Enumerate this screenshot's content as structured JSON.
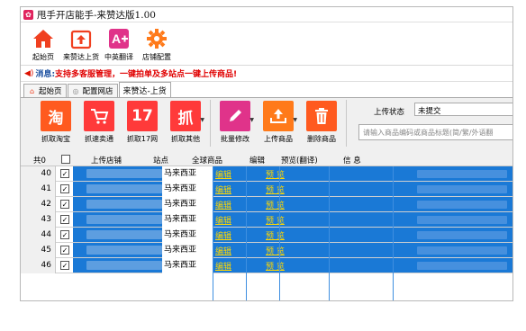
{
  "window": {
    "title": "甩手开店能手-来赞达版1.00"
  },
  "main_toolbar": [
    {
      "label": "起始页",
      "icon": "home-icon"
    },
    {
      "label": "来赞达上货",
      "icon": "upload-box-icon"
    },
    {
      "label": "中英翻译",
      "icon": "translate-icon"
    },
    {
      "label": "店铺配置",
      "icon": "gear-icon"
    }
  ],
  "message": {
    "label": "消息:",
    "text": "支持多客服管理，一键拍单及多站点一键上传商品!"
  },
  "tabs": [
    "起始页",
    "配置网店",
    "来赞达-上货"
  ],
  "tools": [
    {
      "label": "抓取淘宝",
      "glyph": "淘",
      "color": "#ff5a1f"
    },
    {
      "label": "抓速卖通",
      "glyph": "",
      "color": "#ff3a3a"
    },
    {
      "label": "抓取17网",
      "glyph": "17",
      "color": "#ff3a3a"
    },
    {
      "label": "抓取其他",
      "glyph": "抓",
      "color": "#ff3a3a"
    },
    {
      "label": "批量修改",
      "glyph": "",
      "color": "#e0338a"
    },
    {
      "label": "上传商品",
      "glyph": "",
      "color": "#ff7a1a"
    },
    {
      "label": "删除商品",
      "glyph": "",
      "color": "#ff5a1f"
    }
  ],
  "filter": {
    "status_label": "上传状态",
    "status_value": "未提交",
    "search_placeholder": "请输入商品编码或商品标题(简/繁/外语翻"
  },
  "grid": {
    "headers": {
      "count": "共0",
      "store": "上传店铺",
      "site": "站点",
      "global": "全球商品",
      "edit": "编辑",
      "preview": "预览(翻译)",
      "info": "信 息"
    },
    "rows": [
      {
        "num": "40",
        "site": "马来西亚",
        "global": "编辑",
        "preview": "预 览"
      },
      {
        "num": "41",
        "site": "马来西亚",
        "global": "编辑",
        "preview": "预 览"
      },
      {
        "num": "42",
        "site": "马来西亚",
        "global": "编辑",
        "preview": "预 览"
      },
      {
        "num": "43",
        "site": "马来西亚",
        "global": "编辑",
        "preview": "预 览"
      },
      {
        "num": "44",
        "site": "马来西亚",
        "global": "编辑",
        "preview": "预 览"
      },
      {
        "num": "45",
        "site": "马来西亚",
        "global": "编辑",
        "preview": "预 览"
      },
      {
        "num": "46",
        "site": "马来西亚",
        "global": "编辑",
        "preview": "预 览"
      }
    ]
  },
  "colors": {
    "selection": "#1a79d6",
    "link": "#ffd700",
    "message": "#e00000"
  }
}
